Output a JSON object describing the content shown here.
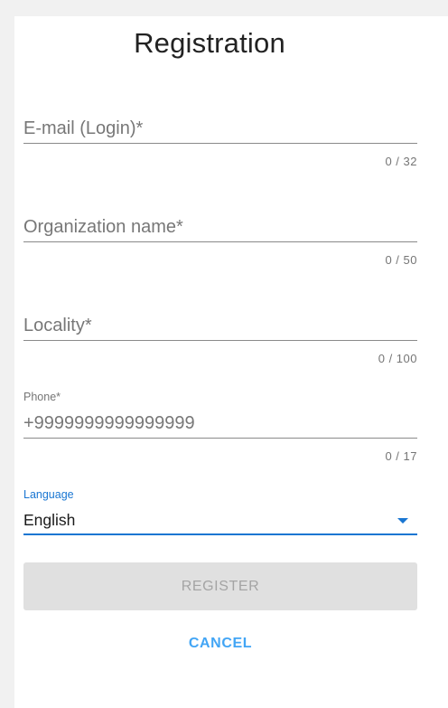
{
  "form": {
    "title": "Registration",
    "email": {
      "placeholder": "E-mail (Login)*",
      "value": "",
      "counter": "0 / 32"
    },
    "organization": {
      "placeholder": "Organization name*",
      "value": "",
      "counter": "0 / 50"
    },
    "locality": {
      "placeholder": "Locality*",
      "value": "",
      "counter": "0 / 100"
    },
    "phone": {
      "label": "Phone*",
      "placeholder": "+9999999999999999",
      "value": "",
      "counter": "0 / 17"
    },
    "language": {
      "label": "Language",
      "selected": "English",
      "icon": "caret-down-icon"
    },
    "buttons": {
      "register": "REGISTER",
      "cancel": "CANCEL"
    }
  },
  "colors": {
    "accent": "#1976d2",
    "cancel_text": "#42a5f5",
    "button_disabled_bg": "#e0e0e0",
    "button_disabled_text": "#a4a4a4",
    "page_bg": "#f1f1f1",
    "card_bg": "#ffffff"
  }
}
